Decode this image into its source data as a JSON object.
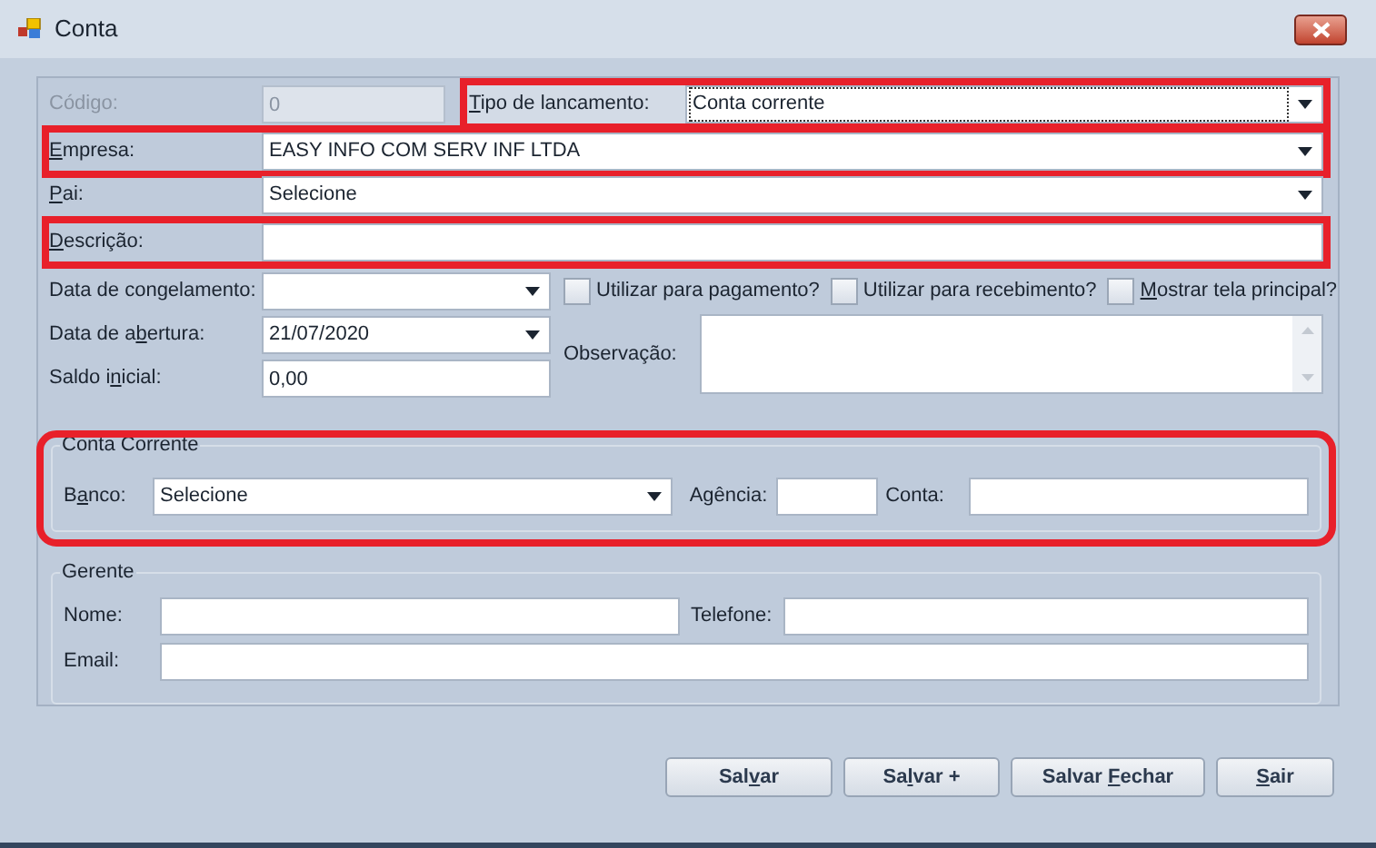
{
  "window": {
    "title": "Conta"
  },
  "form": {
    "codigo": {
      "label": "Código:",
      "value": "0",
      "disabled": true
    },
    "tipo": {
      "label": {
        "key": "T",
        "post": "ipo de lancamento:"
      },
      "value": "Conta corrente",
      "highlighted": true,
      "focused": true
    },
    "empresa": {
      "label": {
        "key": "E",
        "post": "mpresa:"
      },
      "value": "EASY INFO COM  SERV INF LTDA",
      "highlighted": true
    },
    "pai": {
      "label": {
        "key": "P",
        "post": "ai:"
      },
      "value": "Selecione",
      "highlighted": false
    },
    "descricao": {
      "label": {
        "key": "D",
        "post": "escrição:"
      },
      "highlighted": true
    },
    "congelamento": {
      "label": "Data de congelamento:"
    },
    "abertura": {
      "label": {
        "pre": "Data de a",
        "key": "b",
        "post": "ertura:"
      },
      "value": "21/07/2020"
    },
    "saldo": {
      "label": {
        "pre": "Saldo i",
        "key": "n",
        "post": "icial:"
      },
      "value": "0,00"
    },
    "checkboxes": [
      {
        "label": "Utilizar para pagamento?",
        "checked": false
      },
      {
        "label": "Utilizar para recebimento?",
        "checked": false
      },
      {
        "label": {
          "key": "M",
          "post": "ostrar tela principal?"
        },
        "checked": false
      }
    ],
    "observacao": {
      "label": "Observação:"
    }
  },
  "conta_corrente": {
    "title": "Conta Corrente",
    "highlighted": true,
    "banco": {
      "label": {
        "pre": "B",
        "key": "a",
        "post": "nco:"
      },
      "value": "Selecione"
    },
    "agencia": {
      "label": "Agência:"
    },
    "conta": {
      "label": "Conta:"
    }
  },
  "gerente": {
    "title": "Gerente",
    "nome": {
      "label": "Nome:"
    },
    "telefone": {
      "label": "Telefone:"
    },
    "email": {
      "label": "Email:"
    }
  },
  "buttons": [
    {
      "label": {
        "pre": "Sal",
        "key": "v",
        "post": "ar"
      }
    },
    {
      "label": {
        "pre": "Sa",
        "key": "l",
        "post": "var +"
      }
    },
    {
      "label": {
        "pre": "Salvar ",
        "key": "F",
        "post": "echar"
      }
    },
    {
      "label": {
        "key": "S",
        "post": "air"
      }
    }
  ]
}
